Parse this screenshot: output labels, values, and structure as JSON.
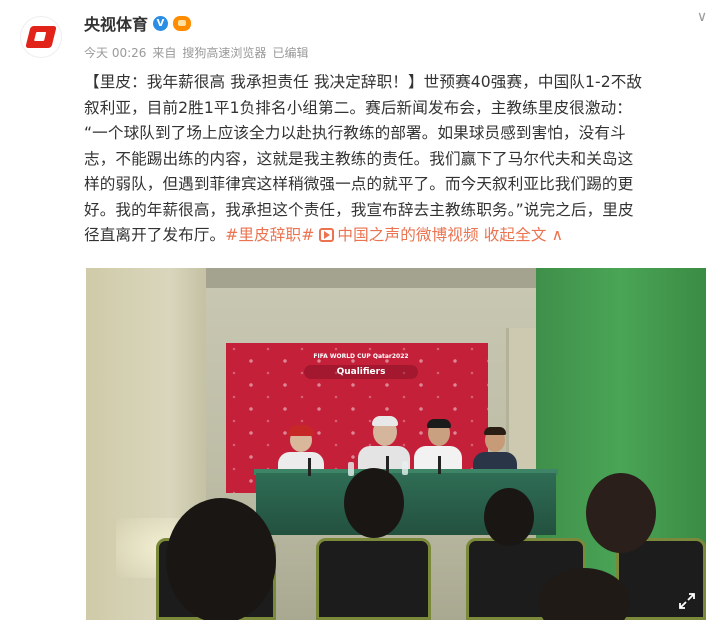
{
  "post": {
    "author": "央视体育",
    "meta": {
      "time": "今天 00:26",
      "source_prefix": "来自",
      "source": "搜狗高速浏览器",
      "edited": "已编辑"
    },
    "text_lines": [
      "【里皮：我年薪很高 我承担责任 我决定辞职！】世预赛40强赛，中国队1-2不敌",
      "叙利亚，目前2胜1平1负排名小组第二。赛后新闻发布会，主教练里皮很激动：",
      "“一个球队到了场上应该全力以赴执行教练的部署。如果球员感到害怕，没有斗",
      "志，不能踢出练的内容，这就是我主教练的责任。我们赢下了马尔代夫和关岛这",
      "样的弱队，但遇到菲律宾这样稍微强一点的就平了。而今天叙利亚比我们踢的更",
      "好。我的年薪很高，我承担这个责任，我宣布辞去主教练职务。”说完之后，里皮"
    ],
    "last_line_text": "径直离开了发布厅。",
    "hashtag": "#里皮辞职#",
    "video_link": "中国之声的微博视频",
    "collapse": "收起全文",
    "collapse_arrow": "∧"
  },
  "video": {
    "backdrop_title": "FIFA WORLD CUP Qatar2022",
    "backdrop_sub": "Qualifiers"
  },
  "icons": {
    "verified": "V",
    "chevron": "∨"
  },
  "colors": {
    "link": "#eb7350",
    "verified": "#2b8de3",
    "brand": "#e2231a",
    "backdrop": "#c5203a",
    "wall_green": "#4aa556"
  }
}
